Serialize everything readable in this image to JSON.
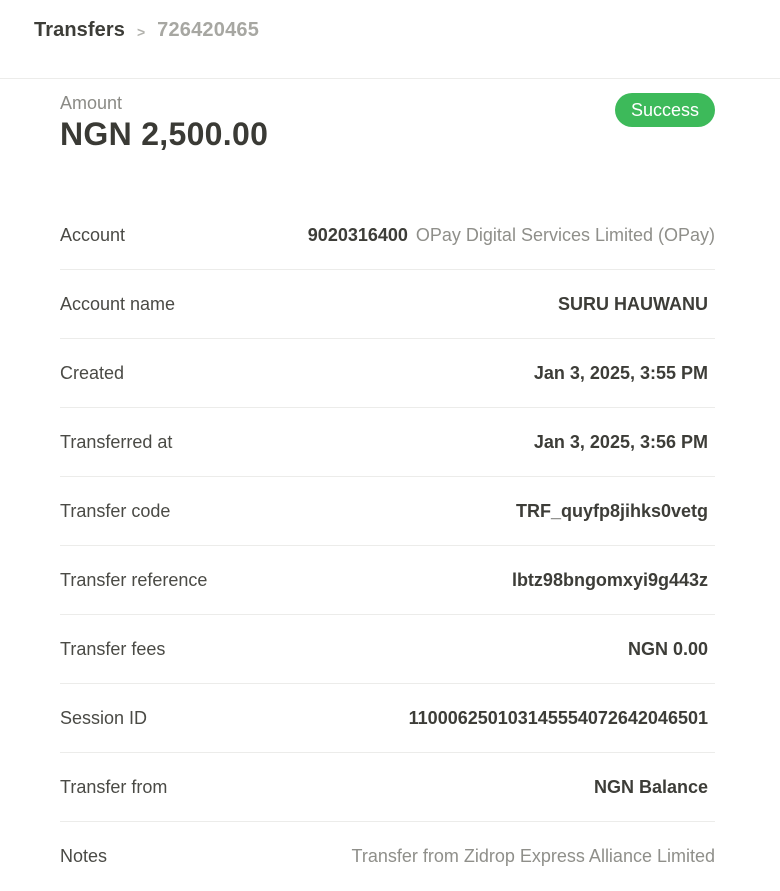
{
  "breadcrumb": {
    "root": "Transfers",
    "separator": ">",
    "current": "726420465"
  },
  "summary": {
    "amount_label": "Amount",
    "amount_value": "NGN 2,500.00",
    "status": "Success",
    "status_color": "#3dba5a"
  },
  "details": {
    "account": {
      "label": "Account",
      "number": "9020316400",
      "bank": "OPay Digital Services Limited (OPay)"
    },
    "account_name": {
      "label": "Account name",
      "value": "SURU HAUWANU"
    },
    "created": {
      "label": "Created",
      "value": "Jan 3, 2025, 3:55 PM"
    },
    "transferred_at": {
      "label": "Transferred at",
      "value": "Jan 3, 2025, 3:56 PM"
    },
    "transfer_code": {
      "label": "Transfer code",
      "value": "TRF_quyfp8jihks0vetg"
    },
    "transfer_reference": {
      "label": "Transfer reference",
      "value": "lbtz98bngomxyi9g443z"
    },
    "transfer_fees": {
      "label": "Transfer fees",
      "value": "NGN 0.00"
    },
    "session_id": {
      "label": "Session ID",
      "value": "110006250103145554072642046501"
    },
    "transfer_from": {
      "label": "Transfer from",
      "value": "NGN Balance"
    },
    "notes": {
      "label": "Notes",
      "value": "Transfer from Zidrop Express Alliance Limited"
    }
  }
}
